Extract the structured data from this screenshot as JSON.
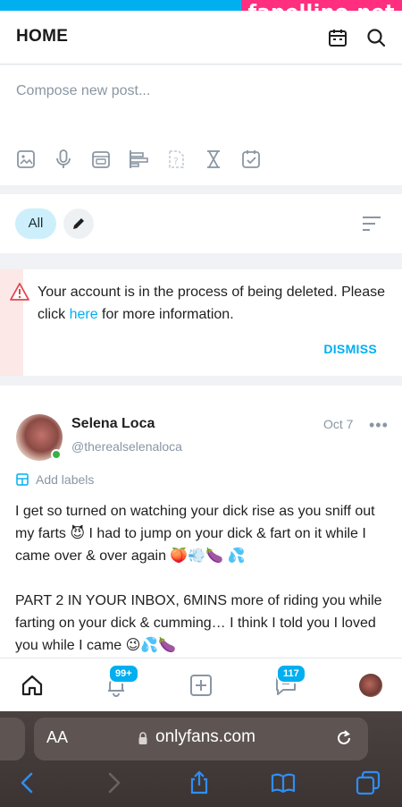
{
  "watermark": "fapellino.net",
  "header": {
    "title": "HOME",
    "icons": [
      "calendar-icon",
      "search-icon"
    ]
  },
  "compose": {
    "placeholder": "Compose new post...",
    "tools": [
      "image-icon",
      "microphone-icon",
      "media-vault-icon",
      "poll-icon",
      "quiz-icon",
      "hourglass-icon",
      "schedule-icon"
    ]
  },
  "filters": {
    "all_label": "All"
  },
  "alert": {
    "message_part1": "Your account is in the process of being deleted. Please click ",
    "link_text": "here",
    "message_part2": " for more information.",
    "dismiss_label": "DISMISS"
  },
  "post": {
    "name": "Selena Loca",
    "handle": "@therealselenaloca",
    "date": "Oct 7",
    "more": "•••",
    "add_labels": "Add labels",
    "text": "I get so turned on watching your dick rise as you sniff out my farts 😈 I had to jump on your dick & fart on it while I came over & over again 🍑💨🍆 💦\n\nPART 2 IN YOUR INBOX, 6MINS more of riding you while farting on your dick & cumming… I think I told you I loved you while I came 😉💦🍆"
  },
  "bottom_nav": {
    "notifications_badge": "99+",
    "messages_badge": "117",
    "items": [
      "home-icon",
      "bell-icon",
      "add-post-icon",
      "messages-icon",
      "profile-avatar"
    ]
  },
  "browser": {
    "text_size": "AA",
    "url": "onlyfans.com",
    "toolbar": [
      "back-icon",
      "forward-icon",
      "share-icon",
      "bookmarks-icon",
      "tabs-icon"
    ]
  },
  "colors": {
    "accent": "#00aff0",
    "alert_bg": "#fde8e8",
    "watermark": "#ff2e7e"
  }
}
